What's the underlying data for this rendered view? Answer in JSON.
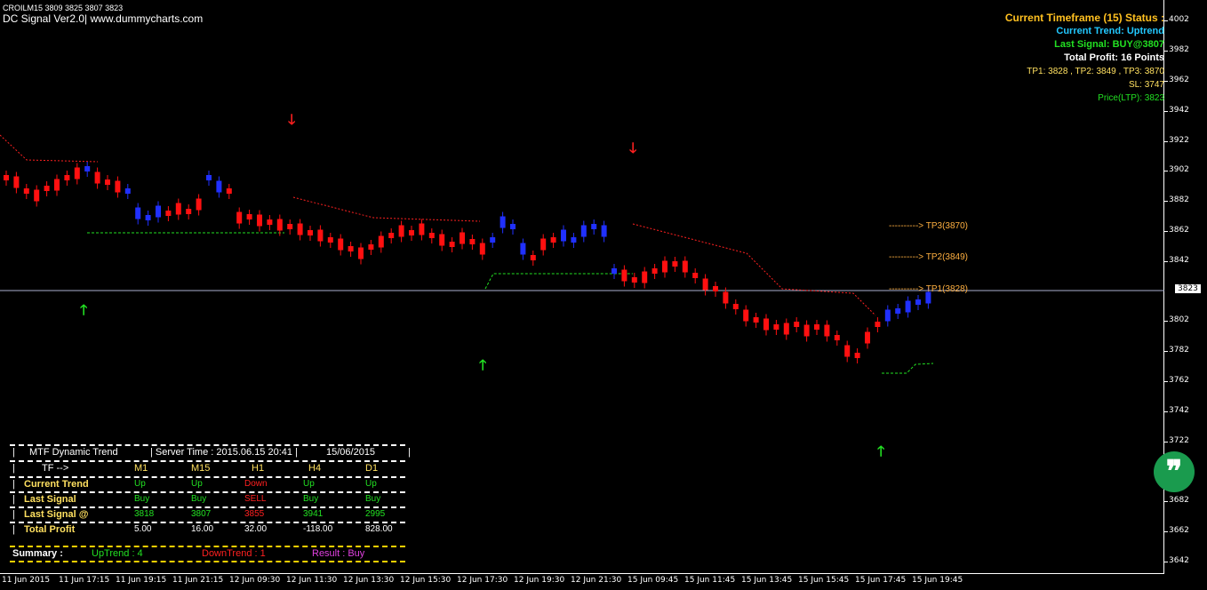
{
  "header": {
    "symbol_line": "CROILM15  3809 3825 3807 3823",
    "indicator_line": "DC Signal Ver2.0| www.dummycharts.com"
  },
  "status": {
    "title": "Current Timeframe (15) Status :",
    "trend": "Current Trend: Uptrend",
    "last_signal": "Last Signal: BUY@3807",
    "total_profit": "Total Profit: 16 Points",
    "tps": "TP1: 3828 , TP2: 3849 , TP3: 3870",
    "sl": "SL: 3747",
    "price": "Price(LTP): 3823",
    "colors": {
      "title": "#ffc020",
      "trend": "#22c8ff",
      "signal": "#22e022",
      "profit": "#ffffff",
      "tps": "#ffe060",
      "sl": "#ffe060",
      "price": "#22e022"
    }
  },
  "targets": [
    {
      "label": "----------> TP3(3870)",
      "price": 3870
    },
    {
      "label": "----------> TP2(3849)",
      "price": 3849
    },
    {
      "label": "----------> TP1(3828)",
      "price": 3828
    }
  ],
  "price_axis": {
    "ticks": [
      "4002",
      "3982",
      "3962",
      "3942",
      "3922",
      "3902",
      "3882",
      "3862",
      "3842",
      "3823",
      "3802",
      "3782",
      "3762",
      "3742",
      "3722",
      "3702",
      "3682",
      "3662",
      "3642"
    ],
    "current": "3823"
  },
  "time_axis": {
    "ticks": [
      "11 Jun 2015",
      "11 Jun 17:15",
      "11 Jun 19:15",
      "11 Jun 21:15",
      "12 Jun 09:30",
      "12 Jun 11:30",
      "12 Jun 13:30",
      "12 Jun 15:30",
      "12 Jun 17:30",
      "12 Jun 19:30",
      "12 Jun 21:30",
      "15 Jun 09:45",
      "15 Jun 11:45",
      "15 Jun 13:45",
      "15 Jun 15:45",
      "15 Jun 17:45",
      "15 Jun 19:45"
    ]
  },
  "mtf_table": {
    "title": "MTF Dynamic Trend",
    "server_time": "| Server Time :  2015.06.15 20:41  |",
    "date": "15/06/2015",
    "headers": [
      "TF -->",
      "M1",
      "M15",
      "H1",
      "H4",
      "D1"
    ],
    "rows": [
      {
        "label": "Current Trend",
        "values": [
          "Up",
          "Up",
          "Down",
          "Up",
          "Up"
        ],
        "colors": [
          "#22e022",
          "#22e022",
          "#ff2020",
          "#22e022",
          "#22e022"
        ]
      },
      {
        "label": "Last Signal",
        "values": [
          "Buy",
          "Buy",
          "SELL",
          "Buy",
          "Buy"
        ],
        "colors": [
          "#22e022",
          "#22e022",
          "#ff2020",
          "#22e022",
          "#22e022"
        ]
      },
      {
        "label": "Last Signal @",
        "values": [
          "3818",
          "3807",
          "3855",
          "3941",
          "2995"
        ],
        "colors": [
          "#22e022",
          "#22e022",
          "#ff2020",
          "#22e022",
          "#22e022"
        ]
      },
      {
        "label": "Total Profit",
        "values": [
          "5.00",
          "16.00",
          "32.00",
          "-118.00",
          "828.00"
        ],
        "colors": [
          "#ffffff",
          "#ffffff",
          "#ffffff",
          "#ffffff",
          "#ffffff"
        ]
      }
    ],
    "summary_label": "Summary :",
    "uptrend": "UpTrend : 4",
    "downtrend": "DownTrend : 1",
    "result": "Result : Buy"
  },
  "chat_button": {
    "glyph": "❞"
  }
}
